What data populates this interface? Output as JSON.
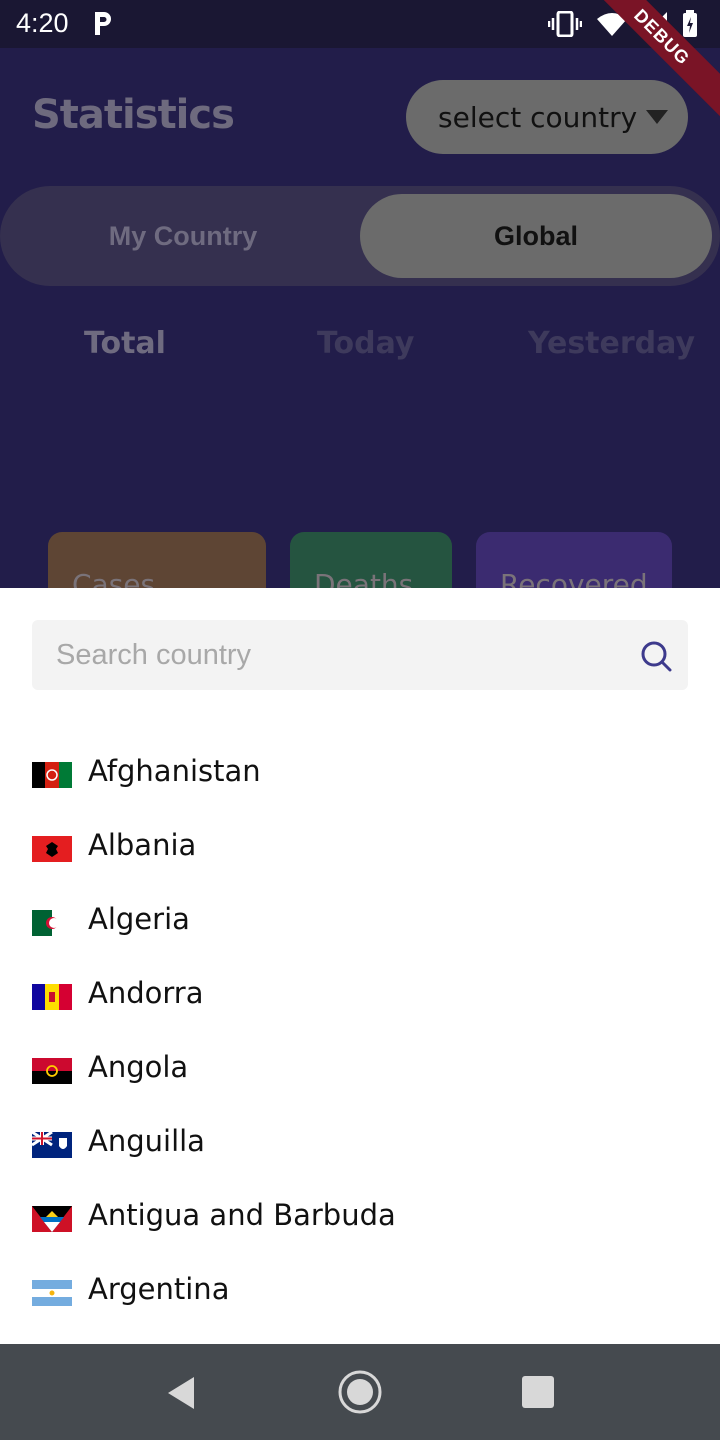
{
  "status_bar": {
    "time": "4:20",
    "debug_label": "DEBUG"
  },
  "header": {
    "title": "Statistics",
    "select_label": "select country"
  },
  "toggle": {
    "my_country": "My Country",
    "global": "Global"
  },
  "tabs": {
    "total": "Total",
    "today": "Today",
    "yesterday": "Yesterday"
  },
  "cards": {
    "cases": "Cases",
    "deaths": "Deaths",
    "recovered": "Recovered"
  },
  "search": {
    "placeholder": "Search country"
  },
  "countries": [
    {
      "name": "Afghanistan",
      "flag": "afghanistan-flag"
    },
    {
      "name": "Albania",
      "flag": "albania-flag"
    },
    {
      "name": "Algeria",
      "flag": "algeria-flag"
    },
    {
      "name": "Andorra",
      "flag": "andorra-flag"
    },
    {
      "name": "Angola",
      "flag": "angola-flag"
    },
    {
      "name": "Anguilla",
      "flag": "anguilla-flag"
    },
    {
      "name": "Antigua and Barbuda",
      "flag": "antigua-flag"
    },
    {
      "name": "Argentina",
      "flag": "argentina-flag"
    }
  ],
  "colors": {
    "app_bg": "#221d4a",
    "accent": "#3d3a8c",
    "sheet_bg": "#ffffff",
    "nav_bg": "#454a4f"
  }
}
